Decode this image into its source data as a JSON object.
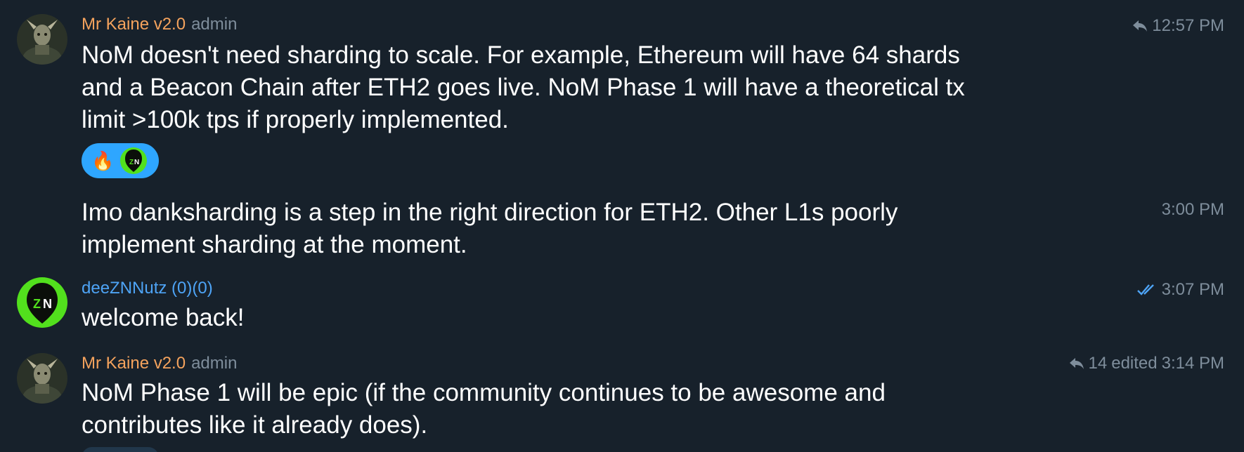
{
  "colors": {
    "background": "#17212b",
    "author_orange": "#f5a35d",
    "author_blue": "#4ea4f6",
    "meta_gray": "#7e8d9b",
    "reaction_bg": "#2ea6ff",
    "znn_green": "#52e01d"
  },
  "messages": [
    {
      "author": "Mr Kaine v2.0",
      "role": "admin",
      "avatar_icon": "warrior-avatar",
      "meta_icon": "reply-icon",
      "replies": "",
      "time": "12:57 PM",
      "text": "NoM doesn't need sharding to scale. For example, Ethereum will have 64 shards and a Beacon Chain after ETH2 goes live. NoM Phase 1 will have a theoretical tx limit >100k tps if properly implemented.",
      "reactions": [
        {
          "icon": "fire-emoji",
          "glyph": "🔥"
        },
        {
          "icon": "znn-logo"
        }
      ]
    },
    {
      "time": "3:00 PM",
      "text": "Imo danksharding is a step in the right direction for ETH2. Other L1s poorly implement sharding at the moment."
    },
    {
      "author": "deeZNNutz (0)(0)",
      "avatar_icon": "znn-logo-avatar",
      "meta_icon": "double-check-icon",
      "time": "3:07 PM",
      "text": "welcome back!"
    },
    {
      "author": "Mr Kaine v2.0",
      "role": "admin",
      "avatar_icon": "warrior-avatar",
      "meta_icon": "reply-icon",
      "replies": "14",
      "edited": "edited",
      "time": "3:14 PM",
      "text": "NoM Phase 1 will be epic (if the community continues to be awesome and contributes like it already does)."
    }
  ]
}
